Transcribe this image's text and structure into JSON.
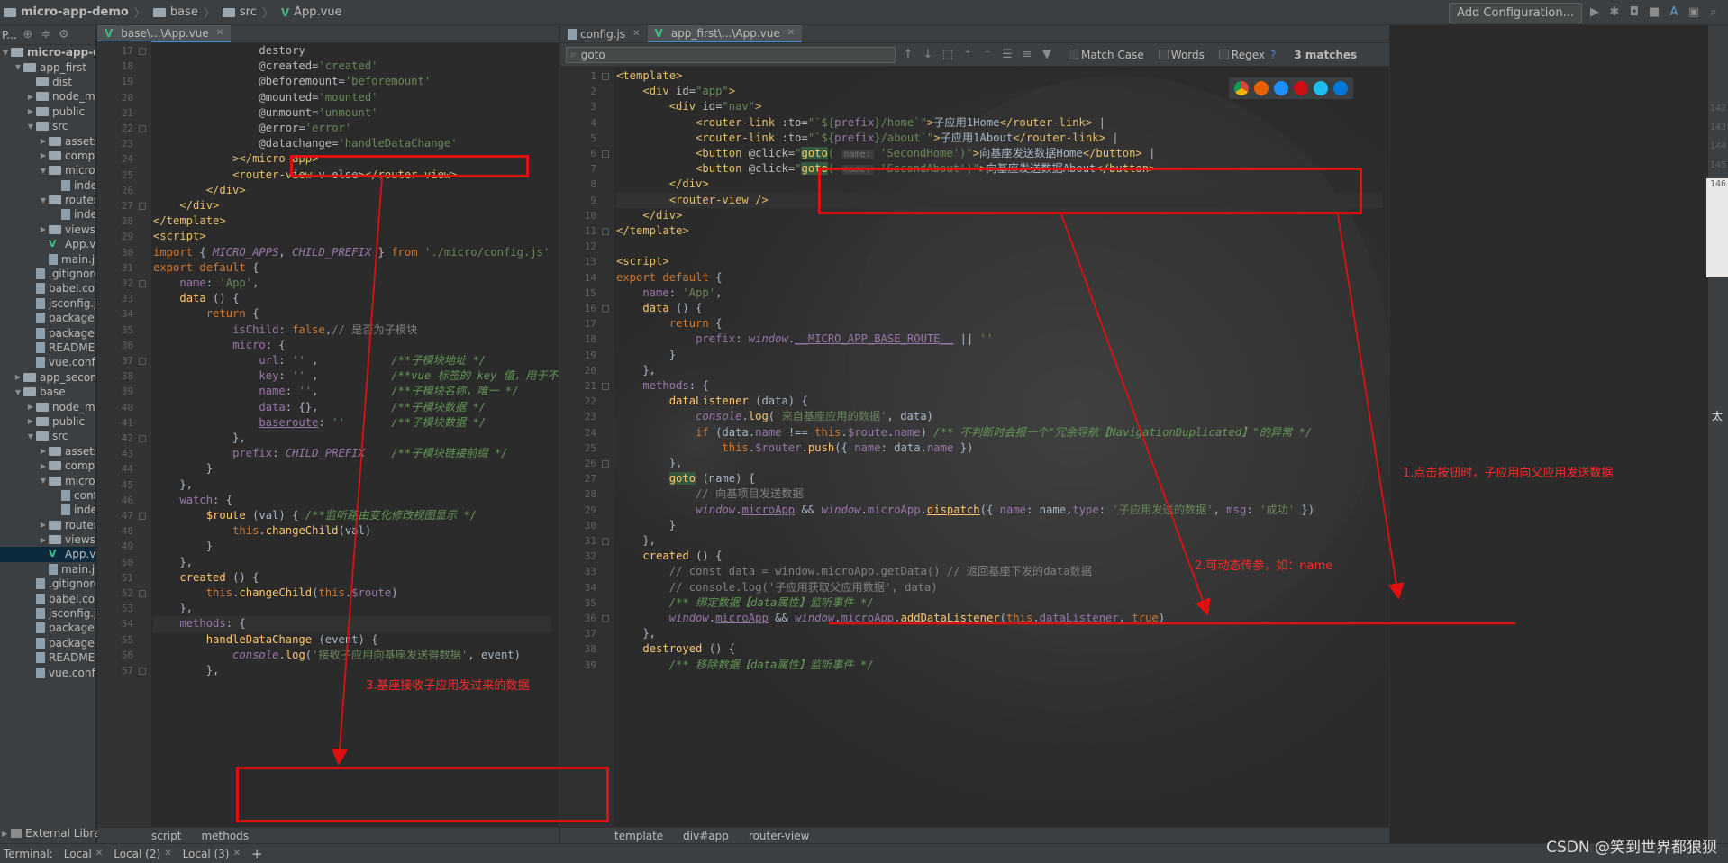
{
  "navbar": {
    "crumbs": [
      "micro-app-demo",
      "base",
      "src",
      "App.vue"
    ],
    "add_configuration": "Add Configuration...",
    "icons": [
      "run-icon",
      "debug-icon",
      "coverage-icon",
      "stop-icon",
      "translate-icon",
      "layout-icon",
      "search-icon"
    ]
  },
  "project": {
    "head_label": "P...",
    "tree": [
      {
        "label": "micro-app-demo",
        "depth": 0,
        "arrow": "down",
        "icon": "folder"
      },
      {
        "label": "app_first",
        "depth": 1,
        "arrow": "down",
        "icon": "folder"
      },
      {
        "label": "dist",
        "depth": 2,
        "arrow": "",
        "icon": "folder"
      },
      {
        "label": "node_modules",
        "depth": 2,
        "arrow": "right",
        "icon": "folder"
      },
      {
        "label": "public",
        "depth": 2,
        "arrow": "right",
        "icon": "folder"
      },
      {
        "label": "src",
        "depth": 2,
        "arrow": "down",
        "icon": "folder"
      },
      {
        "label": "assets",
        "depth": 3,
        "arrow": "right",
        "icon": "folder"
      },
      {
        "label": "components",
        "depth": 3,
        "arrow": "right",
        "icon": "folder"
      },
      {
        "label": "micro",
        "depth": 3,
        "arrow": "down",
        "icon": "folder"
      },
      {
        "label": "index.js",
        "depth": 4,
        "arrow": "",
        "icon": "file"
      },
      {
        "label": "router",
        "depth": 3,
        "arrow": "down",
        "icon": "folder"
      },
      {
        "label": "index.js",
        "depth": 4,
        "arrow": "",
        "icon": "file"
      },
      {
        "label": "views",
        "depth": 3,
        "arrow": "right",
        "icon": "folder"
      },
      {
        "label": "App.vue",
        "depth": 3,
        "arrow": "",
        "icon": "vue"
      },
      {
        "label": "main.js",
        "depth": 3,
        "arrow": "",
        "icon": "file"
      },
      {
        "label": ".gitignore",
        "depth": 2,
        "arrow": "",
        "icon": "file"
      },
      {
        "label": "babel.config.js",
        "depth": 2,
        "arrow": "",
        "icon": "file"
      },
      {
        "label": "jsconfig.json",
        "depth": 2,
        "arrow": "",
        "icon": "file"
      },
      {
        "label": "package.json",
        "depth": 2,
        "arrow": "",
        "icon": "file"
      },
      {
        "label": "package-lock.json",
        "depth": 2,
        "arrow": "",
        "icon": "file"
      },
      {
        "label": "README.md",
        "depth": 2,
        "arrow": "",
        "icon": "file"
      },
      {
        "label": "vue.config.js",
        "depth": 2,
        "arrow": "",
        "icon": "file"
      },
      {
        "label": "app_second",
        "depth": 1,
        "arrow": "right",
        "icon": "folder"
      },
      {
        "label": "base",
        "depth": 1,
        "arrow": "down",
        "icon": "folder"
      },
      {
        "label": "node_modules",
        "depth": 2,
        "arrow": "right",
        "icon": "folder"
      },
      {
        "label": "public",
        "depth": 2,
        "arrow": "right",
        "icon": "folder"
      },
      {
        "label": "src",
        "depth": 2,
        "arrow": "down",
        "icon": "folder"
      },
      {
        "label": "assets",
        "depth": 3,
        "arrow": "right",
        "icon": "folder"
      },
      {
        "label": "components",
        "depth": 3,
        "arrow": "right",
        "icon": "folder"
      },
      {
        "label": "micro",
        "depth": 3,
        "arrow": "down",
        "icon": "folder"
      },
      {
        "label": "config.js",
        "depth": 4,
        "arrow": "",
        "icon": "file"
      },
      {
        "label": "index.js",
        "depth": 4,
        "arrow": "",
        "icon": "file"
      },
      {
        "label": "router",
        "depth": 3,
        "arrow": "right",
        "icon": "folder"
      },
      {
        "label": "views",
        "depth": 3,
        "arrow": "right",
        "icon": "folder"
      },
      {
        "label": "App.vue",
        "depth": 3,
        "arrow": "",
        "icon": "vue",
        "selected": true
      },
      {
        "label": "main.js",
        "depth": 3,
        "arrow": "",
        "icon": "file"
      },
      {
        "label": ".gitignore",
        "depth": 2,
        "arrow": "",
        "icon": "file"
      },
      {
        "label": "babel.config.js",
        "depth": 2,
        "arrow": "",
        "icon": "file"
      },
      {
        "label": "jsconfig.json",
        "depth": 2,
        "arrow": "",
        "icon": "file"
      },
      {
        "label": "package.json",
        "depth": 2,
        "arrow": "",
        "icon": "file"
      },
      {
        "label": "package-lock.json",
        "depth": 2,
        "arrow": "",
        "icon": "file"
      },
      {
        "label": "README.md",
        "depth": 2,
        "arrow": "",
        "icon": "file"
      },
      {
        "label": "vue.config.js",
        "depth": 2,
        "arrow": "",
        "icon": "file"
      }
    ],
    "external_libraries": "External Libraries"
  },
  "left_editor": {
    "tab": "base\\...\\App.vue",
    "breadcrumbs": [
      "script",
      "methods"
    ],
    "lines": [
      {
        "n": 17,
        "html": "                <span class=\"a\">destory</span>"
      },
      {
        "n": 18,
        "html": "                <span class=\"a\">@created</span>=<span class=\"s\">'created'</span>"
      },
      {
        "n": 19,
        "html": "                <span class=\"a\">@beforemount</span>=<span class=\"s\">'beforemount'</span>"
      },
      {
        "n": 20,
        "html": "                <span class=\"a\">@mounted</span>=<span class=\"s\">'mounted'</span>"
      },
      {
        "n": 21,
        "html": "                <span class=\"a\">@unmount</span>=<span class=\"s\">'unmount'</span>"
      },
      {
        "n": 22,
        "html": "                <span class=\"a\">@error</span>=<span class=\"s\">'error'</span>"
      },
      {
        "n": 23,
        "html": "                <span class=\"a\">@datachange</span>=<span class=\"s\">'handleDataChange'</span>"
      },
      {
        "n": 24,
        "html": "            <span class=\"t\">&gt;&lt;/micro-app&gt;</span>"
      },
      {
        "n": 25,
        "html": "            <span class=\"t\">&lt;router-view </span><span class=\"a\">v-else</span><span class=\"t\">&gt;&lt;/router-view&gt;</span>"
      },
      {
        "n": 26,
        "html": "        <span class=\"t\">&lt;/div&gt;</span>"
      },
      {
        "n": 27,
        "html": "    <span class=\"t\">&lt;/div&gt;</span>"
      },
      {
        "n": 28,
        "html": "<span class=\"t\">&lt;/template&gt;</span>"
      },
      {
        "n": 29,
        "html": "<span class=\"t\">&lt;script&gt;</span>"
      },
      {
        "n": 30,
        "html": "<span class=\"k\">import</span> { <span class=\"pi\">MICRO_APPS</span>, <span class=\"pi\">CHILD_PREFIX</span> } <span class=\"k\">from</span> <span class=\"s\">'./micro/config.js'</span>"
      },
      {
        "n": 31,
        "html": "<span class=\"k\">export default</span> {"
      },
      {
        "n": 32,
        "html": "    <span class=\"p\">name</span>: <span class=\"s\">'App'</span>,"
      },
      {
        "n": 33,
        "html": "    <span class=\"f\">data</span> () {"
      },
      {
        "n": 34,
        "html": "        <span class=\"k\">return</span> {"
      },
      {
        "n": 35,
        "html": "            <span class=\"p\">isChild</span>: <span class=\"k\">false</span>,<span class=\"c\">// 是否为子模块</span>"
      },
      {
        "n": 36,
        "html": "            <span class=\"p\">micro</span>: {"
      },
      {
        "n": 37,
        "html": "                <span class=\"p\">url</span>: <span class=\"s\">''</span> ,           <span class=\"cd\">/**子模块地址 */</span>"
      },
      {
        "n": 38,
        "html": "                <span class=\"p\">key</span>: <span class=\"s\">''</span> ,           <span class=\"cd\">/**vue 标签的 key 值，用于不同子模块</span>"
      },
      {
        "n": 39,
        "html": "                <span class=\"p\">name</span>: <span class=\"s\">''</span>,           <span class=\"cd\">/**子模块名称，唯一 */</span>"
      },
      {
        "n": 40,
        "html": "                <span class=\"p\">data</span>: {},           <span class=\"cd\">/**子模块数据 */</span>"
      },
      {
        "n": 41,
        "html": "                <span class=\"p ul\">baseroute</span>: <span class=\"s\">''</span>       <span class=\"cd\">/**子模块数据 */</span>"
      },
      {
        "n": 42,
        "html": "            },"
      },
      {
        "n": 43,
        "html": "            <span class=\"p\">prefix</span>: <span class=\"pi\">CHILD_PREFIX</span>    <span class=\"cd\">/**子模块链接前缀 */</span>"
      },
      {
        "n": 44,
        "html": "        }"
      },
      {
        "n": 45,
        "html": "    },"
      },
      {
        "n": 46,
        "html": "    <span class=\"p\">watch</span>: {"
      },
      {
        "n": 47,
        "html": "        <span class=\"f\">$route</span> (val) { <span class=\"cd\">/**监听路由变化修改视图显示 */</span>"
      },
      {
        "n": 48,
        "html": "            <span class=\"k\">this</span>.<span class=\"f\">changeChild</span>(val)"
      },
      {
        "n": 49,
        "html": "        }"
      },
      {
        "n": 50,
        "html": "    },"
      },
      {
        "n": 51,
        "html": "    <span class=\"f\">created</span> () {"
      },
      {
        "n": 52,
        "html": "        <span class=\"k\">this</span>.<span class=\"f\">changeChild</span>(<span class=\"k\">this</span>.<span class=\"p\">$route</span>)"
      },
      {
        "n": 53,
        "html": "    },"
      },
      {
        "n": 54,
        "html": "    <span class=\"p\">methods</span>: {",
        "current": true
      },
      {
        "n": 55,
        "html": "        <span class=\"f\">handleDataChange</span> (event) {"
      },
      {
        "n": 56,
        "html": "            <span class=\"pi\">console</span>.<span class=\"f\">log</span>(<span class=\"s\">'接收子应用向基座发送得数据'</span>, event)"
      },
      {
        "n": 57,
        "html": "        },"
      }
    ]
  },
  "right_editor": {
    "tabs": [
      {
        "label": "config.js",
        "active": false
      },
      {
        "label": "app_first\\...\\App.vue",
        "active": true
      }
    ],
    "find": {
      "query": "goto",
      "match_case": "Match Case",
      "words": "Words",
      "regex": "Regex",
      "help": "?",
      "matches": "3 matches"
    },
    "breadcrumbs": [
      "template",
      "div#app",
      "router-view"
    ],
    "lines": [
      {
        "n": 1,
        "html": "<span class=\"t\">&lt;template&gt;</span>"
      },
      {
        "n": 2,
        "html": "    <span class=\"t\">&lt;div </span><span class=\"a\">id=</span><span class=\"s\">\"app\"</span><span class=\"t\">&gt;</span>"
      },
      {
        "n": 3,
        "html": "        <span class=\"t\">&lt;div </span><span class=\"a\">id=</span><span class=\"s\">\"nav\"</span><span class=\"t\">&gt;</span>"
      },
      {
        "n": 4,
        "html": "            <span class=\"t\">&lt;router-link </span><span class=\"a\">:to=</span><span class=\"s\">\"`${</span><span class=\"p\">prefix</span><span class=\"s\">}/home`\"</span><span class=\"t\">&gt;</span>子应用1Home<span class=\"t\">&lt;/router-link&gt;</span> |"
      },
      {
        "n": 5,
        "html": "            <span class=\"t\">&lt;router-link </span><span class=\"a\">:to=</span><span class=\"s\">\"`${</span><span class=\"p\">prefix</span><span class=\"s\">}/about`\"</span><span class=\"t\">&gt;</span>子应用1About<span class=\"t\">&lt;/router-link&gt;</span> |"
      },
      {
        "n": 6,
        "html": "            <span class=\"t\">&lt;button </span><span class=\"a\">@click=</span><span class=\"s\">\"</span><span class=\"f hl\">goto</span><span class=\"s\">(</span> <span class=\"hint\">name:</span> <span class=\"s\">'SecondHome')\"</span><span class=\"t\">&gt;</span>向基座发送数据Home<span class=\"t\">&lt;/button&gt;</span> |"
      },
      {
        "n": 7,
        "html": "            <span class=\"t\">&lt;button </span><span class=\"a\">@click=</span><span class=\"s\">\"</span><span class=\"f hl\">goto</span><span class=\"s\">(</span> <span class=\"hint\">name:</span> <span class=\"s\">'SecondAbout')\"</span><span class=\"t\">&gt;</span>向基座发送数据About<span class=\"t\">&lt;/button&gt;</span>"
      },
      {
        "n": 8,
        "html": "        <span class=\"t\">&lt;/div&gt;</span>"
      },
      {
        "n": 9,
        "html": "        <span class=\"t\">&lt;router-view /&gt;</span>",
        "current": true
      },
      {
        "n": 10,
        "html": "    <span class=\"t\">&lt;/div&gt;</span>"
      },
      {
        "n": 11,
        "html": "<span class=\"t\">&lt;/template&gt;</span>"
      },
      {
        "n": 12,
        "html": ""
      },
      {
        "n": 13,
        "html": "<span class=\"t\">&lt;script&gt;</span>"
      },
      {
        "n": 14,
        "html": "<span class=\"k\">export default</span> {"
      },
      {
        "n": 15,
        "html": "    <span class=\"p\">name</span>: <span class=\"s\">'App'</span>,"
      },
      {
        "n": 16,
        "html": "    <span class=\"f\">data</span> () {"
      },
      {
        "n": 17,
        "html": "        <span class=\"k\">return</span> {"
      },
      {
        "n": 18,
        "html": "            <span class=\"p\">prefix</span>: <span class=\"pi\">window</span>.<span class=\"p ul\">__MICRO_APP_BASE_ROUTE__</span> || <span class=\"s\">''</span>"
      },
      {
        "n": 19,
        "html": "        }"
      },
      {
        "n": 20,
        "html": "    },"
      },
      {
        "n": 21,
        "html": "    <span class=\"p\">methods</span>: {"
      },
      {
        "n": 22,
        "html": "        <span class=\"f\">dataListener</span> (data) {"
      },
      {
        "n": 23,
        "html": "            <span class=\"pi\">console</span>.<span class=\"f\">log</span>(<span class=\"s\">'来自基座应用的数据'</span>, data)"
      },
      {
        "n": 24,
        "html": "            <span class=\"k\">if</span> (data.<span class=\"p\">name</span> !== <span class=\"k\">this</span>.<span class=\"p\">$route</span>.<span class=\"p\">name</span>) <span class=\"cd\">/** 不判断时会报一个\"冗余导航【NavigationDuplicated】\"的异常 */</span>"
      },
      {
        "n": 25,
        "html": "                <span class=\"k\">this</span>.<span class=\"p\">$router</span>.<span class=\"f\">push</span>({ <span class=\"p\">name</span>: data.<span class=\"p\">name</span> })"
      },
      {
        "n": 26,
        "html": "        },"
      },
      {
        "n": 27,
        "html": "        <span class=\"f hl\">goto</span> (name) {"
      },
      {
        "n": 28,
        "html": "            <span class=\"c\">// 向基项目发送数据</span>"
      },
      {
        "n": 29,
        "html": "            <span class=\"pi\">window</span>.<span class=\"p ul\">microApp</span> &amp;&amp; <span class=\"pi\">window</span>.<span class=\"p\">microApp</span>.<span class=\"f ul\">dispatch</span>({ <span class=\"p\">name</span>: name,<span class=\"p\">type</span>: <span class=\"s\">'子应用发送的数据'</span>, <span class=\"p\">msg</span>: <span class=\"s\">'成功'</span> })"
      },
      {
        "n": 30,
        "html": "        }"
      },
      {
        "n": 31,
        "html": "    },"
      },
      {
        "n": 32,
        "html": "    <span class=\"f\">created</span> () {"
      },
      {
        "n": 33,
        "html": "        <span class=\"c\">// const data = window.microApp.getData() // 返回基座下发的data数据</span>"
      },
      {
        "n": 34,
        "html": "        <span class=\"c\">// console.log('子应用获取父应用数据', data)</span>"
      },
      {
        "n": 35,
        "html": "        <span class=\"cd\">/** 绑定数据【data属性】监听事件 */</span>"
      },
      {
        "n": 36,
        "html": "        <span class=\"pi\">window</span>.<span class=\"p ul\">microApp</span> &amp;&amp; <span class=\"pi\">window</span>.<span class=\"p\">microApp</span>.<span class=\"f\">addDataListener</span>(<span class=\"k\">this</span>.<span class=\"p\">dataListener</span>, <span class=\"k\">true</span>)"
      },
      {
        "n": 37,
        "html": "    },"
      },
      {
        "n": 38,
        "html": "    <span class=\"f\">destroyed</span> () {"
      },
      {
        "n": 39,
        "html": "        <span class=\"cd\">/** 移除数据【data属性】监听事件 */</span>"
      }
    ]
  },
  "annotations": {
    "note1": "1.点击按钮时，子应用向父应用发送数据",
    "note2": "2.可动态传参，如：name",
    "note3": "3.基座接收子应用发过来的数据"
  },
  "statusbar": {
    "terminal_label": "Terminal:",
    "tabs": [
      "Local",
      "Local (2)",
      "Local (3)"
    ],
    "add": "+"
  },
  "right_gutter_numbers": [
    "142",
    "143",
    "144",
    "145",
    "146"
  ],
  "right_edge_char": "太",
  "watermark": "CSDN @笑到世界都狼狈",
  "colors": {
    "annotation_red": "#e01010",
    "vue_green": "#41b883",
    "editor_bg": "#2b2b2b",
    "panel_bg": "#3c3f41"
  }
}
